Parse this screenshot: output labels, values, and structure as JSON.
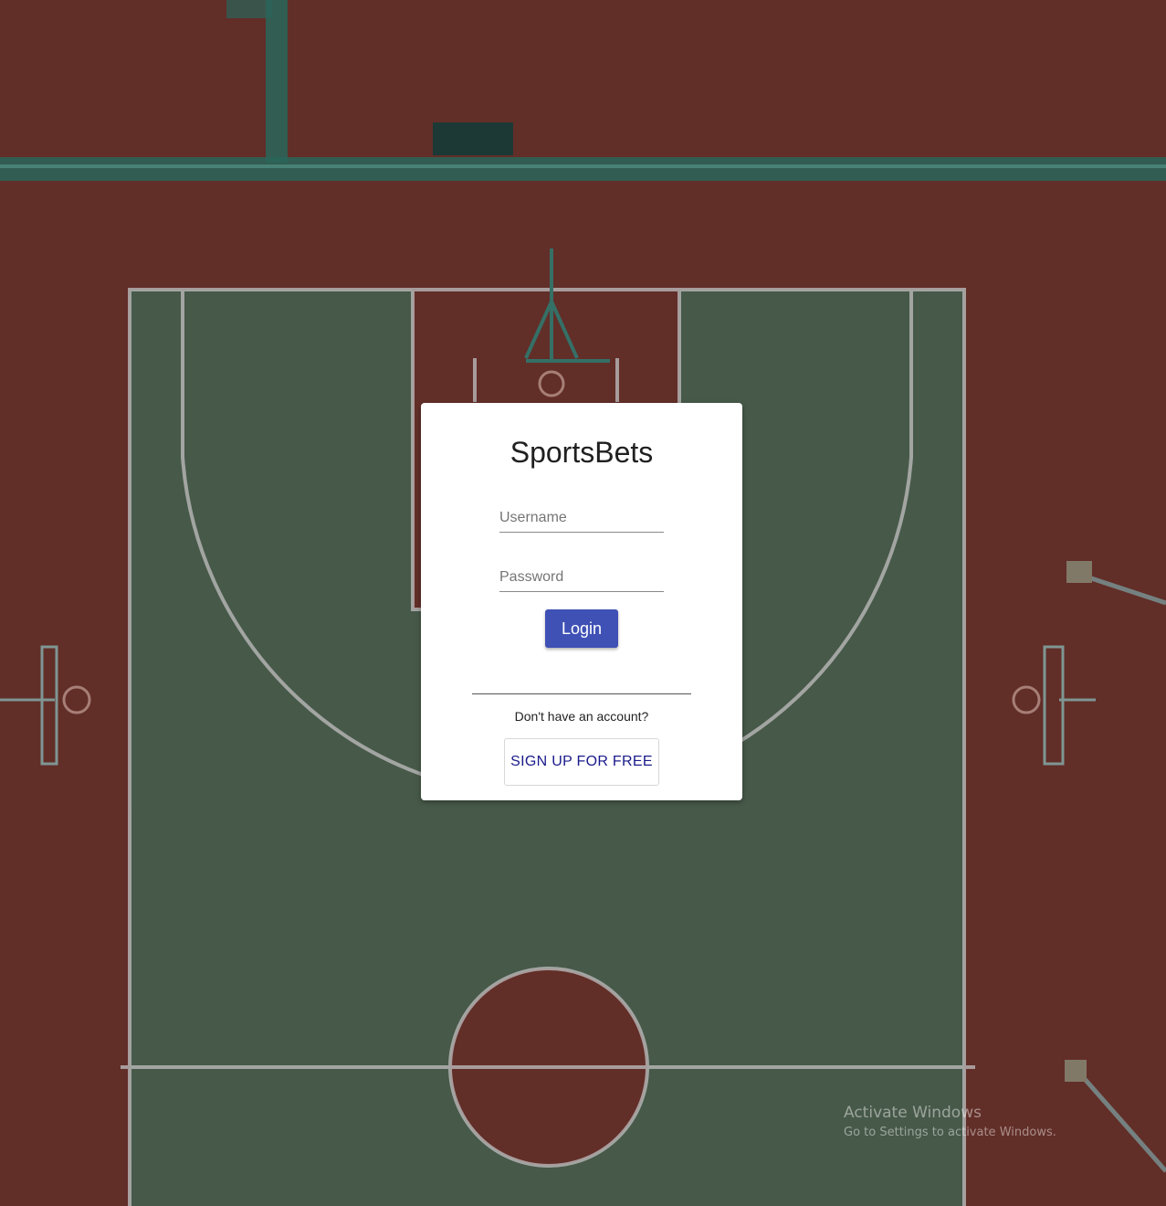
{
  "app": {
    "title": "SportsBets"
  },
  "login_form": {
    "username_placeholder": "Username",
    "password_placeholder": "Password",
    "login_label": "Login"
  },
  "signup": {
    "prompt": "Don't have an account?",
    "button_label": "SIGN UP FOR FREE"
  },
  "watermark": {
    "title": "Activate Windows",
    "subtitle": "Go to Settings to activate Windows."
  },
  "colors": {
    "primary_button": "#3f51b5",
    "signup_text": "#1a1a8c",
    "court_green": "#4e6150",
    "court_red": "#6b322c"
  }
}
